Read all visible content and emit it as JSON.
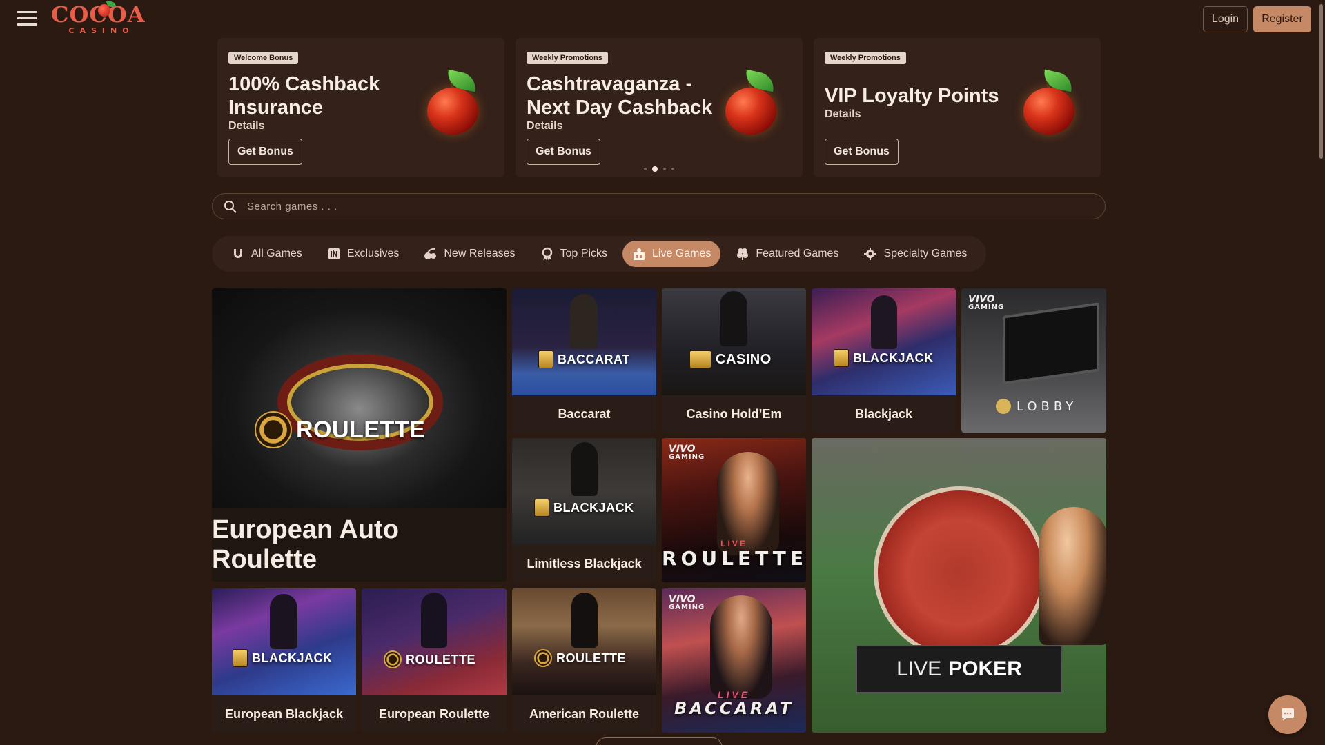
{
  "header": {
    "logo_text": "COCOA",
    "logo_sub": "CASINO",
    "login_label": "Login",
    "register_label": "Register"
  },
  "promos": [
    {
      "tag": "Welcome Bonus",
      "title": "100% Cashback Insurance",
      "details": "Details",
      "button": "Get Bonus"
    },
    {
      "tag": "Weekly Promotions",
      "title": "Cashtravaganza - Next Day Cashback",
      "details": "Details",
      "button": "Get Bonus"
    },
    {
      "tag": "Weekly Promotions",
      "title": "VIP Loyalty Points",
      "details": "Details",
      "button": "Get Bonus"
    }
  ],
  "carousel": {
    "total": 4,
    "active": 1
  },
  "search": {
    "placeholder": "Search games . . ."
  },
  "tabs": [
    {
      "label": "All Games",
      "icon": "horseshoe-icon"
    },
    {
      "label": "Exclusives",
      "icon": "exclusive-icon"
    },
    {
      "label": "New Releases",
      "icon": "cherries-icon"
    },
    {
      "label": "Top Picks",
      "icon": "award-icon"
    },
    {
      "label": "Live Games",
      "icon": "live-dealer-icon",
      "active": true
    },
    {
      "label": "Featured Games",
      "icon": "clover-icon"
    },
    {
      "label": "Specialty Games",
      "icon": "gear-icon"
    }
  ],
  "games": {
    "european_auto_roulette": {
      "title": "European Auto Roulette",
      "badge": "ROULETTE"
    },
    "baccarat": {
      "title": "Baccarat",
      "badge": "BACCARAT"
    },
    "casino_holdem": {
      "title": "Casino Hold’Em",
      "badge": "CASINO"
    },
    "blackjack": {
      "title": "Blackjack",
      "badge": "BLACKJACK"
    },
    "lobby": {
      "vivo": "VIVO",
      "vivo_sub": "GAMING",
      "label": "LOBBY"
    },
    "limitless_blackjack": {
      "title": "Limitless Blackjack",
      "badge": "BLACKJACK"
    },
    "live_roulette": {
      "vivo": "VIVO",
      "vivo_sub": "GAMING",
      "live": "LIVE",
      "label": "ROULETTE"
    },
    "live_poker": {
      "live": "LIVE",
      "label": "POKER"
    },
    "european_blackjack": {
      "title": "European Blackjack",
      "badge": "BLACKJACK"
    },
    "european_roulette": {
      "title": "European Roulette",
      "badge": "ROULETTE"
    },
    "american_roulette": {
      "title": "American Roulette",
      "badge": "ROULETTE"
    },
    "live_baccarat": {
      "vivo": "VIVO",
      "vivo_sub": "GAMING",
      "live": "LIVE",
      "label": "BACCARAT"
    }
  },
  "colors": {
    "background": "#2b1a12",
    "accent": "#c58965",
    "card": "#34211a"
  }
}
